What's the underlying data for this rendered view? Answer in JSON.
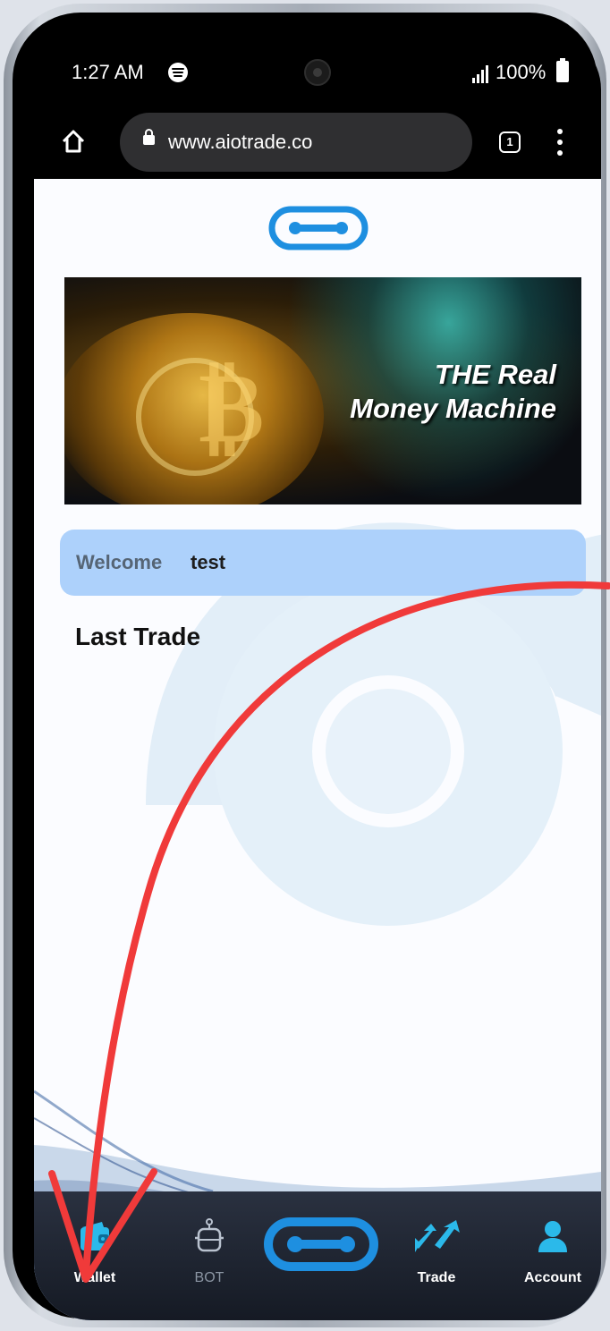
{
  "status_bar": {
    "time": "1:27 AM",
    "battery": "100%"
  },
  "browser": {
    "url": "www.aiotrade.co",
    "tab_count": "1"
  },
  "banner": {
    "line1": "THE Real",
    "line2": "Money Machine"
  },
  "welcome": {
    "label": "Welcome",
    "user": "test"
  },
  "main": {
    "section_title": "Last Trade"
  },
  "bottom_nav": {
    "items": [
      {
        "label": "Wallet",
        "icon": "wallet-icon"
      },
      {
        "label": "BOT",
        "icon": "robot-icon"
      },
      {
        "label": "",
        "icon": "chain-logo-icon"
      },
      {
        "label": "Trade",
        "icon": "swap-arrows-icon"
      },
      {
        "label": "Account",
        "icon": "user-icon"
      }
    ]
  },
  "colors": {
    "brand_blue": "#1e8fe0",
    "wallet_cyan": "#2bb9ea",
    "welcome_bg": "#add1fb",
    "annotation_arrow": "#f03a3a"
  }
}
